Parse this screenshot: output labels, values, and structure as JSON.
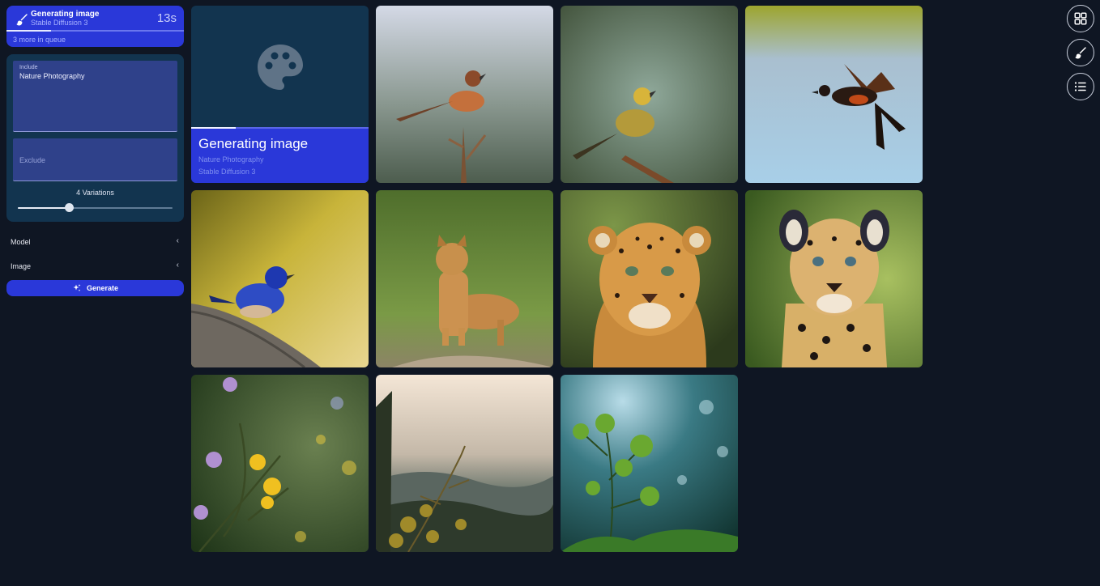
{
  "status": {
    "title": "Generating image",
    "model": "Stable Diffusion 3",
    "timer": "13s",
    "queue": "3 more in queue",
    "progress": 0.25
  },
  "prompt": {
    "include_label": "Include",
    "include_value": "Nature Photography",
    "exclude_placeholder": "Exclude",
    "variations_label": "4 Variations",
    "variations_level": 0.33
  },
  "sections": [
    {
      "label": "Model",
      "icon": "chevron-left-icon"
    },
    {
      "label": "Image",
      "icon": "chevron-left-icon"
    }
  ],
  "generate": {
    "label": "Generate",
    "icon": "sparkle-icon"
  },
  "generating_tile": {
    "title": "Generating image",
    "prompt": "Nature Photography",
    "model": "Stable Diffusion 3",
    "icon": "palette-icon",
    "progress": 0.25
  },
  "gallery": [
    {
      "subject": "bird-on-branch"
    },
    {
      "subject": "finch-on-branch"
    },
    {
      "subject": "bird-in-flight"
    },
    {
      "subject": "bluebird-on-log"
    },
    {
      "subject": "cougar-on-path"
    },
    {
      "subject": "leopard-portrait"
    },
    {
      "subject": "jaguar-portrait"
    },
    {
      "subject": "wildflowers"
    },
    {
      "subject": "misty-valley-plant"
    },
    {
      "subject": "green-foliage"
    }
  ],
  "rail": [
    {
      "icon": "grid-icon"
    },
    {
      "icon": "brush-icon"
    },
    {
      "icon": "list-icon"
    }
  ],
  "colors": {
    "background": "#0f1623",
    "accent": "#2a38d9",
    "panel": "#12344f"
  }
}
